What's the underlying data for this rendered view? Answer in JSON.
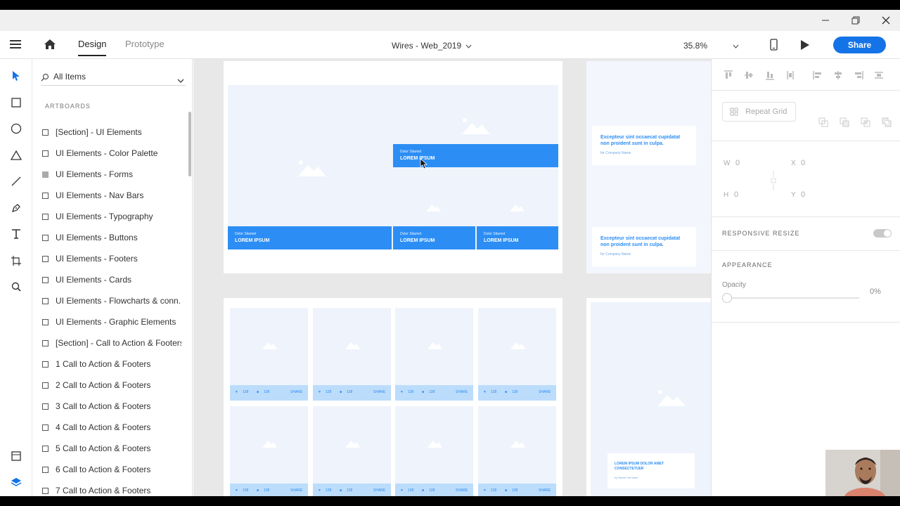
{
  "window": {
    "minimize_icon": "minimize-icon",
    "restore_icon": "restore-icon",
    "close_icon": "close-icon"
  },
  "header": {
    "tabs": [
      {
        "label": "Design"
      },
      {
        "label": "Prototype"
      }
    ],
    "document_title": "Wires - Web_2019",
    "zoom": "35.8%",
    "share_label": "Share"
  },
  "layers": {
    "search_placeholder": "All Items",
    "section_label": "ARTBOARDS",
    "items": [
      {
        "label": "[Section] - UI Elements"
      },
      {
        "label": "UI Elements - Color Palette"
      },
      {
        "label": "UI Elements - Forms"
      },
      {
        "label": "UI Elements - Nav Bars"
      },
      {
        "label": "UI Elements - Typography"
      },
      {
        "label": "UI Elements - Buttons"
      },
      {
        "label": "UI Elements - Footers"
      },
      {
        "label": "UI Elements - Cards"
      },
      {
        "label": "UI Elements - Flowcharts & conn..."
      },
      {
        "label": "UI Elements - Graphic Elements"
      },
      {
        "label": "[Section] - Call to Action & Footers"
      },
      {
        "label": "1 Call to Action & Footers"
      },
      {
        "label": "2 Call to Action & Footers"
      },
      {
        "label": "3 Call to Action & Footers"
      },
      {
        "label": "4 Call to Action & Footers"
      },
      {
        "label": "5 Call to Action & Footers"
      },
      {
        "label": "6 Call to Action & Footers"
      },
      {
        "label": "7 Call to Action & Footers"
      }
    ]
  },
  "canvas": {
    "hero_overlay": {
      "small": "Dolor Sitamet",
      "big": "LOREM IPSUM"
    },
    "bottom_tiles": [
      {
        "small": "Dolor Sitamet",
        "big": "LOREM IPSUM"
      },
      {
        "small": "Dolor Sitamet",
        "big": "LOREM IPSUM"
      },
      {
        "small": "Dolor Sitamet",
        "big": "LOREM IPSUM"
      }
    ],
    "quote_text": "Excepteur sint occaecat cupidatat non proident sunt in culpa.",
    "quote_author": "for Company Name",
    "card_meta": {
      "likes": "128",
      "comments": "128",
      "share": "SHARE"
    },
    "article_title": "LOREM IPSUM DOLOR AMET CONSECTETUER",
    "article_author": "by Name Surname"
  },
  "properties": {
    "repeat_grid_label": "Repeat Grid",
    "w_label": "W",
    "w_value": "0",
    "h_label": "H",
    "h_value": "0",
    "x_label": "X",
    "x_value": "0",
    "y_label": "Y",
    "y_value": "0",
    "responsive_resize_label": "RESPONSIVE RESIZE",
    "appearance_label": "APPEARANCE",
    "opacity_label": "Opacity",
    "opacity_value": "0%"
  },
  "colors": {
    "accent": "#1473e6",
    "wire_blue": "#2c8ef4",
    "wire_bg": "#eef3fc"
  }
}
